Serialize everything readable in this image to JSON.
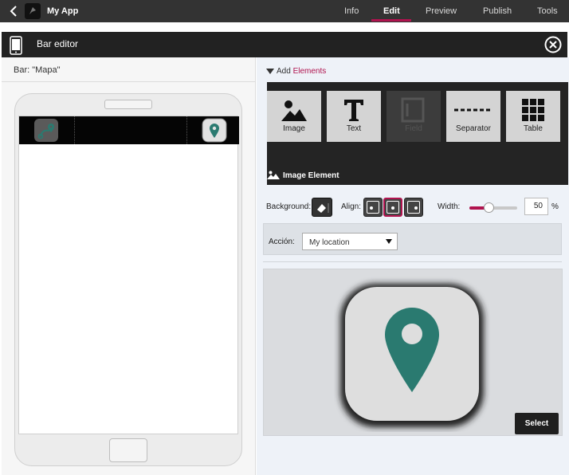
{
  "topbar": {
    "app_name": "My App",
    "tabs": [
      {
        "label": "Info"
      },
      {
        "label": "Edit"
      },
      {
        "label": "Preview"
      },
      {
        "label": "Publish"
      },
      {
        "label": "Tools"
      }
    ],
    "active_tab": "Edit"
  },
  "editor": {
    "title": "Bar editor"
  },
  "left": {
    "bar_title": "Bar: \"Mapa\""
  },
  "add_elements": {
    "prefix": "Add",
    "accent": "Elements"
  },
  "elements": [
    {
      "label": "Image",
      "icon": "image-icon",
      "enabled": true
    },
    {
      "label": "Text",
      "icon": "text-icon",
      "enabled": true
    },
    {
      "label": "Field",
      "icon": "field-icon",
      "enabled": false
    },
    {
      "label": "Separator",
      "icon": "separator-icon",
      "enabled": true
    },
    {
      "label": "Table",
      "icon": "table-icon",
      "enabled": true
    }
  ],
  "image_element": {
    "label": "Image Element"
  },
  "props": {
    "background_label": "Background:",
    "align_label": "Align:",
    "align_selected": "center",
    "width_label": "Width:",
    "width_value": "50",
    "width_unit": "%",
    "width_fraction": 0.5
  },
  "action": {
    "label": "Acción:",
    "selected": "My location"
  },
  "preview": {
    "select_label": "Select"
  },
  "colors": {
    "accent": "#b0134e",
    "marker": "#2a7a70"
  }
}
